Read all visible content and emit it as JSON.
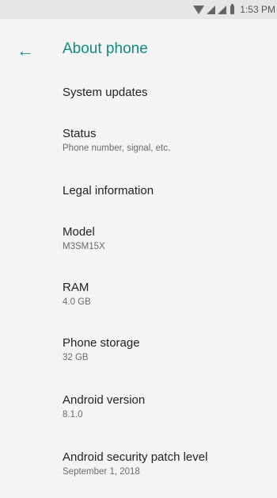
{
  "status_bar": {
    "time": "1:53 PM",
    "icons": [
      "wifi-icon",
      "signal-icon",
      "signal-icon",
      "battery-icon"
    ]
  },
  "header": {
    "back_icon": "arrow-left-icon",
    "title": "About phone"
  },
  "items": [
    {
      "title": "System updates"
    },
    {
      "title": "Status",
      "subtitle": "Phone number, signal, etc."
    },
    {
      "title": "Legal information"
    },
    {
      "title": "Model",
      "subtitle": "M3SM15X"
    },
    {
      "title": "RAM",
      "subtitle": "4.0 GB"
    },
    {
      "title": "Phone storage",
      "subtitle": "32 GB"
    },
    {
      "title": "Android version",
      "subtitle": "8.1.0"
    },
    {
      "title": "Android security patch level",
      "subtitle": "September 1, 2018"
    }
  ]
}
